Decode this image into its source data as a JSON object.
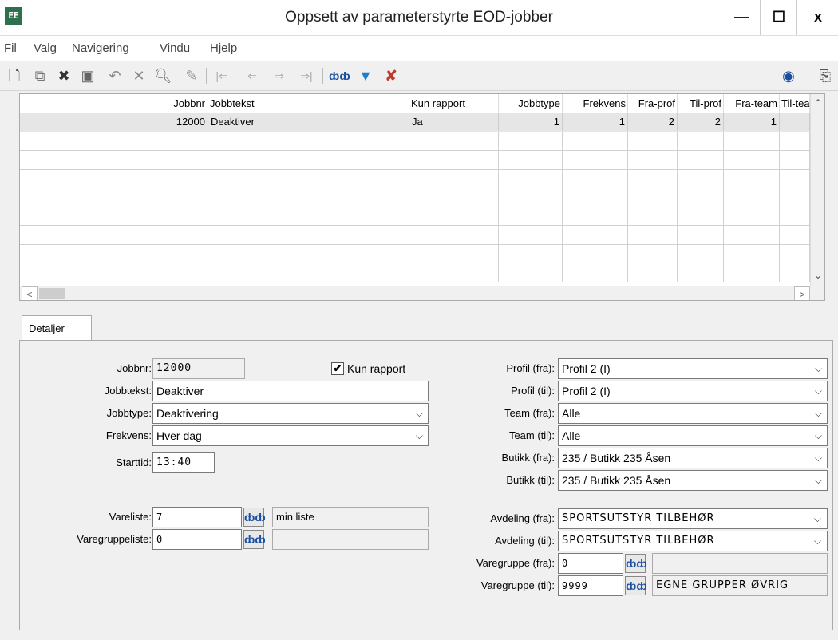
{
  "window": {
    "title": "Oppsett av parameterstyrte EOD-jobber",
    "app_icon_text": "EE",
    "minimize": "—",
    "maximize": "☐",
    "close": "x"
  },
  "menu": [
    "Fil",
    "Valg",
    "Navigering",
    "Vindu",
    "Hjelp"
  ],
  "grid": {
    "headers": [
      "Jobbnr",
      "Jobbtekst",
      "Kun rapport",
      "Jobbtype",
      "Frekvens",
      "Fra-prof",
      "Til-prof",
      "Fra-team",
      "Til-tea"
    ],
    "rows": [
      [
        "12000",
        "Deaktiver",
        "Ja",
        "1",
        "1",
        "2",
        "2",
        "1",
        ""
      ]
    ]
  },
  "tabs": [
    "Detaljer"
  ],
  "details": {
    "jobbnr_label": "Jobbnr:",
    "jobbnr": "12000",
    "kun_rapport_label": "Kun rapport",
    "kun_rapport_checked": true,
    "jobbtekst_label": "Jobbtekst:",
    "jobbtekst": "Deaktiver",
    "jobbtype_label": "Jobbtype:",
    "jobbtype": "Deaktivering",
    "frekvens_label": "Frekvens:",
    "frekvens": "Hver dag",
    "starttid_label": "Starttid:",
    "starttid": "13:40",
    "vareliste_label": "Vareliste:",
    "vareliste": "7",
    "vareliste_name": "min liste",
    "varegruppeliste_label": "Varegruppeliste:",
    "varegruppeliste": "0",
    "varegruppeliste_name": "",
    "profil_fra_label": "Profil (fra):",
    "profil_fra": "Profil 2 (I)",
    "profil_til_label": "Profil (til):",
    "profil_til": "Profil 2 (I)",
    "team_fra_label": "Team (fra):",
    "team_fra": "Alle",
    "team_til_label": "Team (til):",
    "team_til": "Alle",
    "butikk_fra_label": "Butikk (fra):",
    "butikk_fra": "235 / Butikk 235 Åsen",
    "butikk_til_label": "Butikk (til):",
    "butikk_til": "235 / Butikk 235 Åsen",
    "avdeling_fra_label": "Avdeling (fra):",
    "avdeling_fra": "SPORTSUTSTYR TILBEHØR",
    "avdeling_til_label": "Avdeling (til):",
    "avdeling_til": "SPORTSUTSTYR TILBEHØR",
    "varegruppe_fra_label": "Varegruppe (fra):",
    "varegruppe_fra": "0",
    "varegruppe_fra_name": "",
    "varegruppe_til_label": "Varegruppe (til):",
    "varegruppe_til": "9999",
    "varegruppe_til_name": "EGNE GRUPPER ØVRIG"
  }
}
